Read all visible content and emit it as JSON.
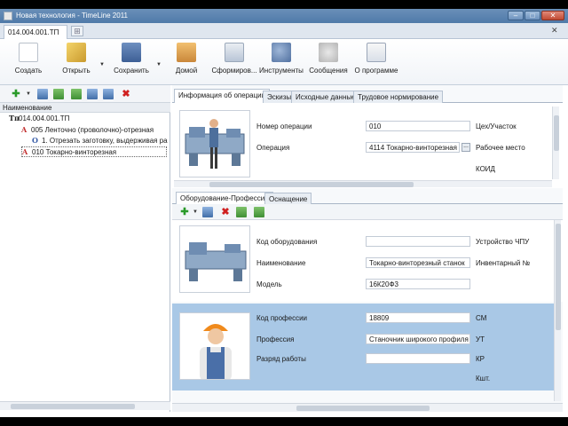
{
  "window": {
    "title": "Новая технология - TimeLine 2011",
    "controls": [
      "–",
      "□",
      "✕"
    ]
  },
  "doc_tabs": [
    {
      "label": "014.004.001.ТП"
    }
  ],
  "ribbon": {
    "buttons": [
      {
        "label": "Создать",
        "icon": "new-document-icon"
      },
      {
        "label": "Открыть",
        "icon": "open-folder-icon"
      },
      {
        "label": "Сохранить",
        "icon": "save-icon"
      },
      {
        "label": "Домой",
        "icon": "home-icon"
      },
      {
        "label": "Сформиров...",
        "icon": "form-report-icon"
      },
      {
        "label": "Инструменты",
        "icon": "tools-icon"
      },
      {
        "label": "Сообщения",
        "icon": "messages-icon"
      },
      {
        "label": "О программе",
        "icon": "about-icon"
      }
    ]
  },
  "tree": {
    "header": "Наименование",
    "items": [
      {
        "glyph": "Тп",
        "label": "014.004.001.ТП"
      },
      {
        "glyph": "A",
        "label": "005 Ленточно (проволочно)-отрезная"
      },
      {
        "glyph": "O",
        "label": "1. Отрезать заготовку, выдерживая ра"
      },
      {
        "glyph": "A",
        "label": "010 Токарно-винторезная"
      }
    ]
  },
  "main_tabs": [
    "Информация об операции",
    "Эскизы",
    "Исходные данные",
    "Трудовое нормирование"
  ],
  "operation": {
    "number_label": "Номер операции",
    "number_value": "010",
    "op_label": "Операция",
    "op_value": "4114 Токарно-винторезная",
    "workshop_label": "Цех/Участок",
    "workplace_label": "Рабочее место",
    "koid_label": "КОИД"
  },
  "sub_tabs": [
    "Оборудование-Профессия",
    "Оснащение"
  ],
  "equipment": {
    "code_label": "Код оборудования",
    "code_value": "",
    "name_label": "Наименование",
    "name_value": "Токарно-винторезный станок",
    "model_label": "Модель",
    "model_value": "16К20Ф3",
    "cnc_label": "Устройство ЧПУ",
    "inv_label": "Инвентарный №"
  },
  "profession": {
    "code_label": "Код профессии",
    "code_value": "18809",
    "prof_label": "Профессия",
    "prof_value": "Станочник широкого профиля",
    "grade_label": "Разряд работы",
    "grade_value": "",
    "right_labels": [
      "СМ",
      "УТ",
      "КР",
      "Кшт."
    ]
  },
  "colors": {
    "selection": "#a9c8e6",
    "titlebar": "#4f7aa9"
  }
}
